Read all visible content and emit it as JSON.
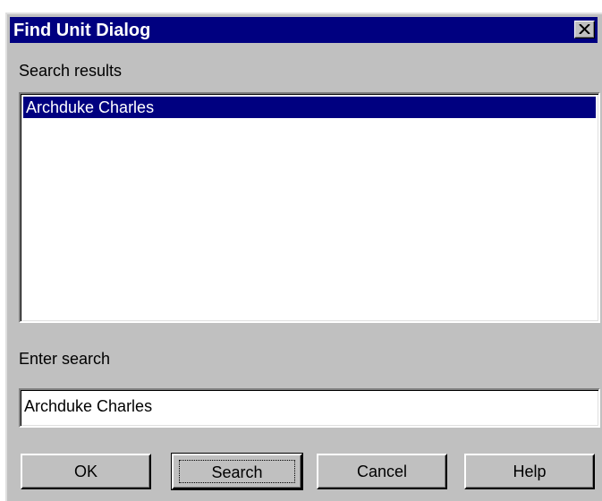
{
  "window": {
    "title": "Find Unit Dialog",
    "close_icon": "close-icon"
  },
  "results": {
    "label": "Search results",
    "items": [
      "Archduke Charles"
    ],
    "selected_index": 0
  },
  "search": {
    "label": "Enter search",
    "value": "Archduke Charles"
  },
  "buttons": {
    "ok": "OK",
    "search": "Search",
    "cancel": "Cancel",
    "help": "Help"
  },
  "colors": {
    "titlebar": "#000080",
    "face": "#c0c0c0",
    "selection": "#000080"
  }
}
